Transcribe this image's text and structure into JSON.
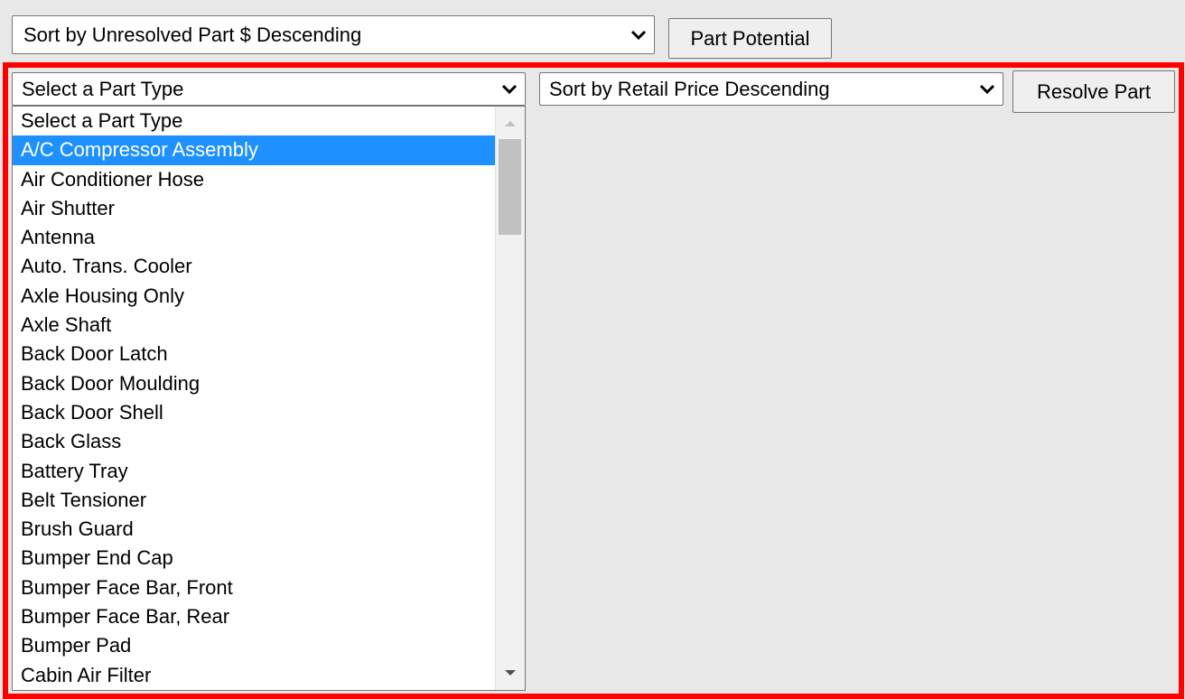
{
  "top_sort": {
    "value": "Sort by Unresolved Part $ Descending",
    "icon": "chevron-down-icon"
  },
  "part_potential_button": "Part Potential",
  "accent_color": "#ff0000",
  "selection_color": "#1e90ff",
  "part_type_select": {
    "value": "Select a Part Type",
    "icon": "chevron-down-icon",
    "selected_index": 1,
    "options": [
      "Select a Part Type",
      "A/C Compressor Assembly",
      "Air Conditioner Hose",
      "Air Shutter",
      "Antenna",
      "Auto. Trans. Cooler",
      "Axle Housing Only",
      "Axle Shaft",
      "Back Door Latch",
      "Back Door Moulding",
      "Back Door Shell",
      "Back Glass",
      "Battery Tray",
      "Belt Tensioner",
      "Brush Guard",
      "Bumper End Cap",
      "Bumper Face Bar, Front",
      "Bumper Face Bar, Rear",
      "Bumper Pad",
      "Cabin Air Filter"
    ]
  },
  "retail_sort": {
    "value": "Sort by Retail Price Descending",
    "icon": "chevron-down-icon"
  },
  "resolve_button": "Resolve Part"
}
